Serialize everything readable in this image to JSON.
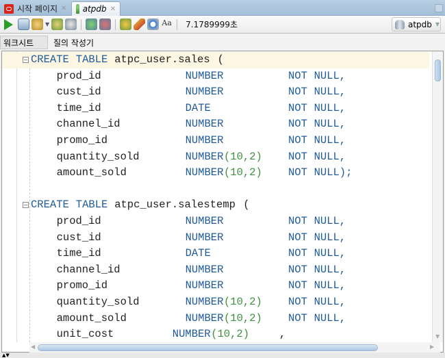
{
  "tabs": [
    {
      "label": "시작 페이지",
      "icon": "oracle-icon"
    },
    {
      "label": "atpdb",
      "icon": "sql-worksheet-icon",
      "active": true
    }
  ],
  "toolbar": {
    "buttons": [
      "run-statement-icon",
      "run-script-icon",
      "commit-icon",
      "autotrace-icon",
      "explain-plan-icon",
      "commit-check-icon",
      "rollback-icon",
      "sql-tuning-icon",
      "clear-icon",
      "history-icon",
      "format-icon"
    ],
    "timing": "7.1789999초",
    "connection": "atpdb"
  },
  "subtabs": [
    {
      "label": "워크시트"
    },
    {
      "label": "질의 작성기"
    }
  ],
  "colors": {
    "keyword": "#1f5b9c",
    "number": "#3f8f3f",
    "current_line": "#fcf6e3",
    "tabbar": "#a9c4dd"
  },
  "code": {
    "tables": [
      {
        "header": [
          "CREATE",
          "TABLE",
          "atpc_user.sales",
          "("
        ],
        "columns": [
          [
            "prod_id",
            "NUMBER",
            "",
            "NOT",
            "NULL,"
          ],
          [
            "cust_id",
            "NUMBER",
            "",
            "NOT",
            "NULL,"
          ],
          [
            "time_id",
            "DATE",
            "",
            "NOT",
            "NULL,"
          ],
          [
            "channel_id",
            "NUMBER",
            "",
            "NOT",
            "NULL,"
          ],
          [
            "promo_id",
            "NUMBER",
            "",
            "NOT",
            "NULL,"
          ],
          [
            "quantity_sold",
            "NUMBER",
            "(10,2)",
            "NOT",
            "NULL,"
          ],
          [
            "amount_sold",
            "NUMBER",
            "(10,2)",
            "NOT",
            "NULL);"
          ]
        ]
      },
      {
        "header": [
          "CREATE",
          "TABLE",
          "atpc_user.salestemp",
          "("
        ],
        "columns": [
          [
            "prod_id",
            "NUMBER",
            "",
            "NOT",
            "NULL,"
          ],
          [
            "cust_id",
            "NUMBER",
            "",
            "NOT",
            "NULL,"
          ],
          [
            "time_id",
            "DATE",
            "",
            "NOT",
            "NULL,"
          ],
          [
            "channel_id",
            "NUMBER",
            "",
            "NOT",
            "NULL,"
          ],
          [
            "promo_id",
            "NUMBER",
            "",
            "NOT",
            "NULL,"
          ],
          [
            "quantity_sold",
            "NUMBER",
            "(10,2)",
            "NOT",
            "NULL,"
          ],
          [
            "amount_sold",
            "NUMBER",
            "(10,2)",
            "NOT",
            "NULL,"
          ],
          [
            "unit_cost",
            "NUMBER",
            "(10,2)",
            "",
            ","
          ]
        ]
      }
    ]
  }
}
